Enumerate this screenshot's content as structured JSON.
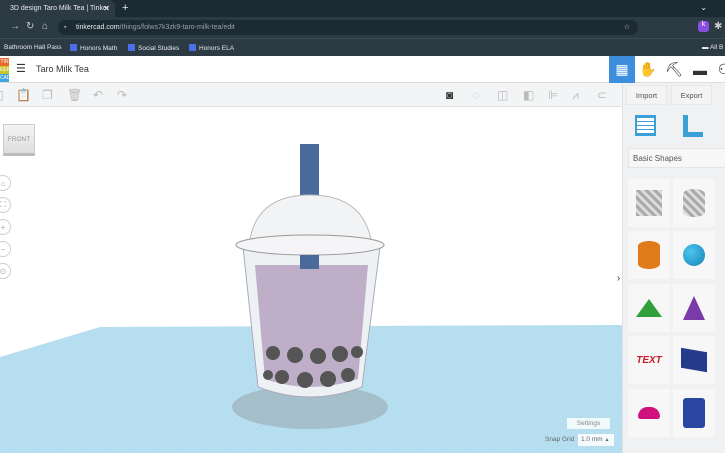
{
  "browser": {
    "tab_title": "3D design Taro Milk Tea | Tinker",
    "url_host": "tinkercad.com",
    "url_path": "/things/folws7k3zk9-taro-milk-tea/edit",
    "bookmarks": [
      "Bathroom Hall Pass",
      "Honors Math",
      "Social Studies",
      "Honors ELA"
    ],
    "all_bookmarks": "All B"
  },
  "app": {
    "logo_letters": [
      "TIN",
      "KER",
      "CAD"
    ],
    "design_title": "Taro Milk Tea"
  },
  "panel": {
    "import_label": "Import",
    "export_label": "Export",
    "shapes_category": "Basic Shapes",
    "shapes": [
      "Box",
      "Cylinder",
      "Cylinder",
      "Sphere",
      "Roof",
      "Cone",
      "Text",
      "Wedge",
      "Half Sphere",
      "Polygon"
    ]
  },
  "workspace": {
    "view_cube_label": "FRONT",
    "settings_label": "Settings",
    "snap_grid_label": "Snap Grid",
    "snap_grid_value": "1.0 mm"
  },
  "colors": {
    "accent": "#3d8fde",
    "straw": "#4a6a9c",
    "tea": "#bfaec8",
    "grid": "#a6d8ec"
  }
}
